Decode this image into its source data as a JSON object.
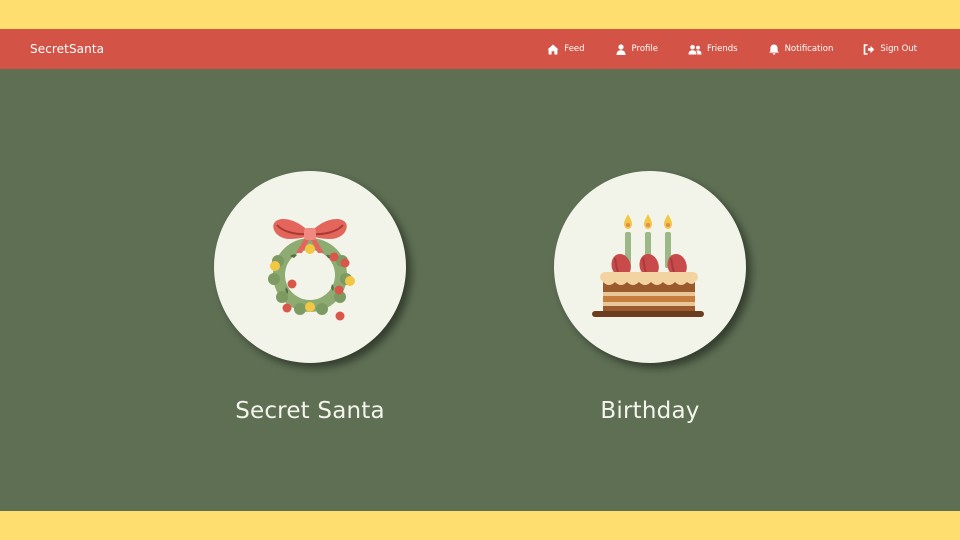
{
  "colors": {
    "banner": "#ffde70",
    "navbar": "#d35446",
    "background": "#5e6f54",
    "circle": "#f2f4ea",
    "text": "#ffffff"
  },
  "navbar": {
    "brand": "SecretSanta",
    "items": [
      {
        "label": "Feed",
        "icon": "home-icon"
      },
      {
        "label": "Profile",
        "icon": "user-icon"
      },
      {
        "label": "Friends",
        "icon": "users-icon"
      },
      {
        "label": "Notification",
        "icon": "bell-icon"
      },
      {
        "label": "Sign Out",
        "icon": "sign-out-icon"
      }
    ]
  },
  "cards": [
    {
      "label": "Secret Santa",
      "icon": "wreath-icon"
    },
    {
      "label": "Birthday",
      "icon": "birthday-cake-icon"
    }
  ]
}
